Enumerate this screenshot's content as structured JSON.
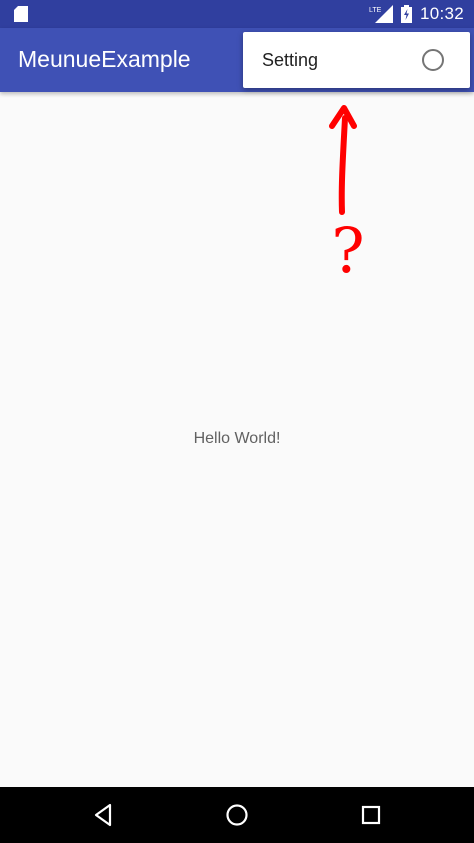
{
  "status_bar": {
    "time": "10:32",
    "network_label": "LTE",
    "icons": [
      "sd-card-icon",
      "lte-signal-icon",
      "battery-charging-icon"
    ]
  },
  "app_bar": {
    "title": "MeunueExample"
  },
  "overflow_menu": {
    "items": [
      {
        "label": "Setting",
        "control": "radio-button",
        "checked": false
      }
    ]
  },
  "content": {
    "message": "Hello World!"
  },
  "annotation": {
    "symbol": "?",
    "color": "#ff0000"
  },
  "nav_bar": {
    "buttons": [
      "back-icon",
      "home-icon",
      "recents-icon"
    ]
  },
  "colors": {
    "status_bar": "#303f9f",
    "app_bar": "#3f51b5",
    "background": "#fafafa",
    "nav_bar": "#000000"
  }
}
